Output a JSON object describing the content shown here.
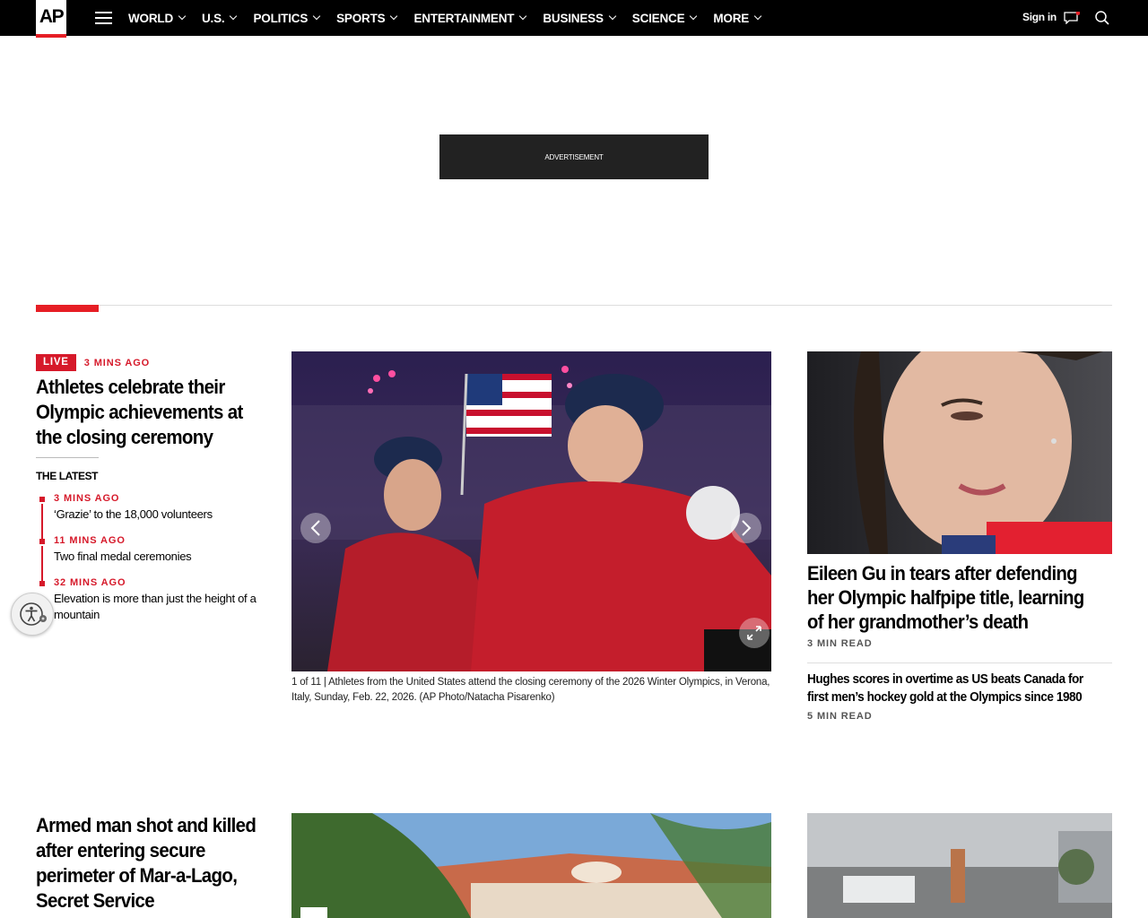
{
  "nav": {
    "logo": "AP",
    "links": [
      "WORLD",
      "U.S.",
      "POLITICS",
      "SPORTS",
      "ENTERTAINMENT",
      "BUSINESS",
      "SCIENCE",
      "MORE"
    ],
    "signin": "Sign in"
  },
  "ad": {
    "label": "ADVERTISEMENT"
  },
  "lead": {
    "live": "LIVE",
    "time": "3 MINS AGO",
    "headline": "Athletes celebrate their Olympic achievements at the closing ceremony",
    "latest_label": "THE LATEST",
    "latest": [
      {
        "time": "3 MINS AGO",
        "text": "‘Grazie’ to the 18,000 volunteers"
      },
      {
        "time": "11 MINS AGO",
        "text": "Two final medal ceremonies"
      },
      {
        "time": "32 MINS AGO",
        "text": "Elevation is more than just the height of a mountain"
      }
    ]
  },
  "gallery": {
    "counter": "1 of 11 |",
    "caption": "Athletes from the United States attend the closing ceremony of the 2026 Winter Olympics, in Verona, Italy, Sunday, Feb. 22, 2026. (AP Photo/Natacha Pisarenko)"
  },
  "right": {
    "headline": "Eileen Gu in tears after defending her Olympic halfpipe title, learning of her grandmother’s death",
    "read1": "3 MIN READ",
    "headline2": "Hughes scores in overtime as US beats Canada for first men’s hockey gold at the Olympics since 1980",
    "read2": "5 MIN READ"
  },
  "second": {
    "headline": "Armed man shot and killed after entering secure perimeter of Mar-a-Lago, Secret Service"
  },
  "colors": {
    "accent": "#e61e25",
    "live": "#d6192a",
    "nav_bg": "#000000"
  }
}
